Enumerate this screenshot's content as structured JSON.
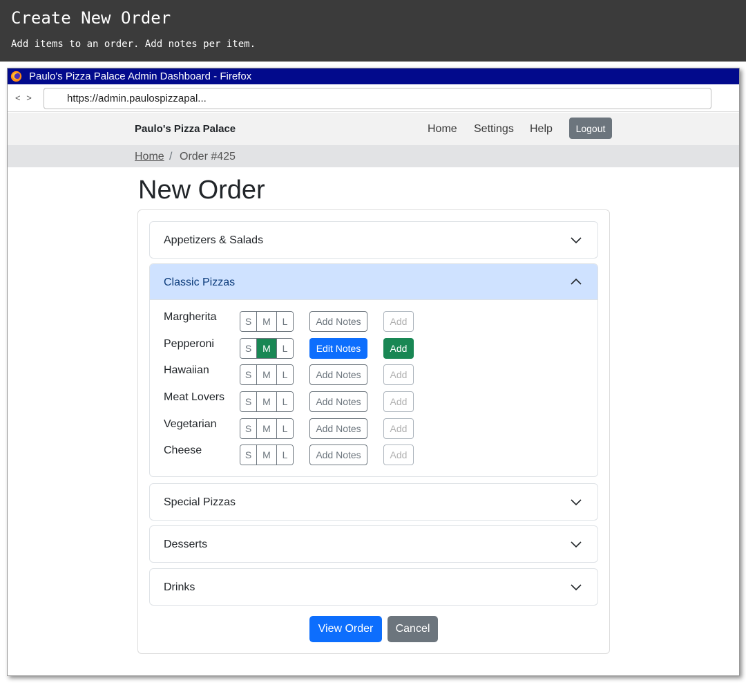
{
  "banner": {
    "title": "Create New Order",
    "subtitle": "Add items to an order. Add notes per item."
  },
  "browser": {
    "title": "Paulo's Pizza Palace Admin Dashboard - Firefox",
    "back": "<",
    "forward": ">",
    "url": "https://admin.paulospizzapal..."
  },
  "navbar": {
    "brand": "Paulo's Pizza Palace",
    "links": [
      "Home",
      "Settings",
      "Help"
    ],
    "logout": "Logout"
  },
  "breadcrumb": {
    "home": "Home",
    "separator": "/",
    "current": "Order #425"
  },
  "page": {
    "title": "New Order"
  },
  "accordion": {
    "sections": [
      {
        "label": "Appetizers & Salads",
        "expanded": false
      },
      {
        "label": "Classic Pizzas",
        "expanded": true
      },
      {
        "label": "Special Pizzas",
        "expanded": false
      },
      {
        "label": "Desserts",
        "expanded": false
      },
      {
        "label": "Drinks",
        "expanded": false
      }
    ]
  },
  "sizes": [
    "S",
    "M",
    "L"
  ],
  "items": [
    {
      "name": "Margherita",
      "selected_size": "",
      "notes_label": "Add Notes",
      "add_label": "Add",
      "add_enabled": false
    },
    {
      "name": "Pepperoni",
      "selected_size": "M",
      "notes_label": "Edit Notes",
      "add_label": "Add",
      "add_enabled": true
    },
    {
      "name": "Hawaiian",
      "selected_size": "",
      "notes_label": "Add Notes",
      "add_label": "Add",
      "add_enabled": false
    },
    {
      "name": "Meat Lovers",
      "selected_size": "",
      "notes_label": "Add Notes",
      "add_label": "Add",
      "add_enabled": false
    },
    {
      "name": "Vegetarian",
      "selected_size": "",
      "notes_label": "Add Notes",
      "add_label": "Add",
      "add_enabled": false
    },
    {
      "name": "Cheese",
      "selected_size": "",
      "notes_label": "Add Notes",
      "add_label": "Add",
      "add_enabled": false
    }
  ],
  "actions": {
    "view_order": "View Order",
    "cancel": "Cancel"
  },
  "colors": {
    "banner_bg": "#3b3b3b",
    "titlebar_bg": "#020a8c",
    "primary": "#0d6efd",
    "success": "#198754",
    "secondary": "#6c757d",
    "accordion_active_bg": "#cfe2ff"
  }
}
